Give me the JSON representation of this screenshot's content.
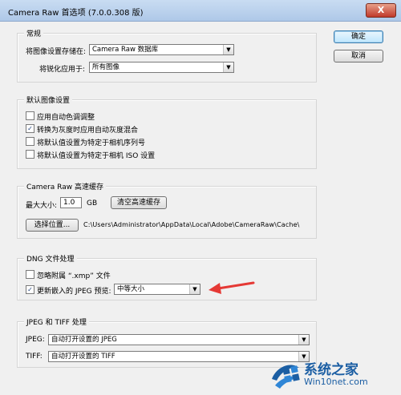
{
  "window": {
    "title": "Camera Raw 首选项 (7.0.0.308 版)",
    "close_label": "X"
  },
  "buttons": {
    "ok": "确定",
    "cancel": "取消"
  },
  "general": {
    "label": "常规",
    "save_settings_label": "将图像设置存储在:",
    "save_settings_value": "Camera Raw 数据库",
    "sharpen_label": "将锐化应用于:",
    "sharpen_value": "所有图像"
  },
  "default_settings": {
    "label": "默认图像设置",
    "items": [
      {
        "label": "应用自动色调调整",
        "checked": false
      },
      {
        "label": "转换为灰度时应用自动灰度混合",
        "checked": true
      },
      {
        "label": "将默认值设置为特定于相机序列号",
        "checked": false
      },
      {
        "label": "将默认值设置为特定于相机 ISO 设置",
        "checked": false
      }
    ],
    "check_mark": "✓"
  },
  "cache": {
    "label": "Camera Raw 高速缓存",
    "max_size_label": "最大大小:",
    "max_size_value": "1.0",
    "unit": "GB",
    "purge_button": "清空高速缓存",
    "select_location_button": "选择位置...",
    "path": "C:\\Users\\Administrator\\AppData\\Local\\Adobe\\CameraRaw\\Cache\\"
  },
  "dng": {
    "label": "DNG 文件处理",
    "ignore_xmp": "忽略附属 “.xmp” 文件",
    "update_jpeg": "更新嵌入的 JPEG 预览:",
    "preview_size": "中等大小",
    "check_mark": "✓"
  },
  "jpeg_tiff": {
    "label": "JPEG 和 TIFF 处理",
    "jpeg_label": "JPEG:",
    "jpeg_value": "自动打开设置的 JPEG",
    "tiff_label": "TIFF:",
    "tiff_value": "自动打开设置的 TIFF"
  },
  "watermark": {
    "name": "系统之家",
    "url": "Win10net.com"
  },
  "colors": {
    "annotation_arrow": "#e53935",
    "watermark": "#1b5ea3"
  }
}
